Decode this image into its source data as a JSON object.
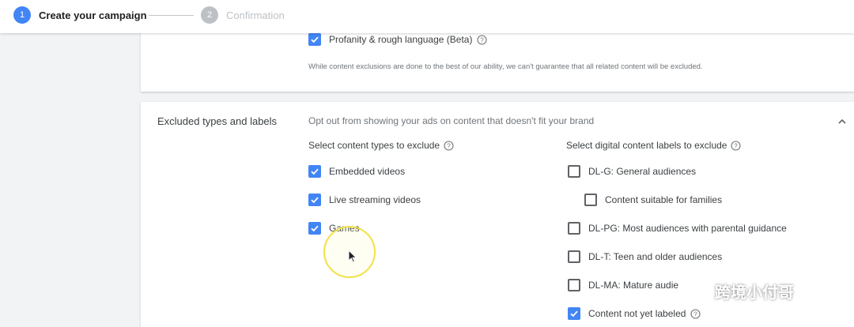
{
  "stepper": {
    "steps": [
      {
        "number": "1",
        "label": "Create your campaign"
      },
      {
        "number": "2",
        "label": "Confirmation"
      }
    ]
  },
  "top_card": {
    "partial_option": "Profanity & rough language (Beta)",
    "disclaimer": "While content exclusions are done to the best of our ability, we can't guarantee that all related content will be excluded."
  },
  "excluded_section": {
    "title": "Excluded types and labels",
    "description": "Opt out from showing your ads on content that doesn't fit your brand",
    "content_types": {
      "heading": "Select content types to exclude",
      "items": [
        {
          "label": "Embedded videos",
          "checked": true
        },
        {
          "label": "Live streaming videos",
          "checked": true
        },
        {
          "label": "Games",
          "checked": true
        }
      ]
    },
    "digital_labels": {
      "heading": "Select digital content labels to exclude",
      "items": [
        {
          "label": "DL-G: General audiences",
          "checked": false
        },
        {
          "label": "Content suitable for families",
          "checked": false
        },
        {
          "label": "DL-PG: Most audiences with parental guidance",
          "checked": false
        },
        {
          "label": "DL-T: Teen and older audiences",
          "checked": false
        },
        {
          "label": "DL-MA: Mature audie",
          "checked": false
        },
        {
          "label": "Content not yet labeled",
          "checked": true
        }
      ]
    }
  },
  "watermark": {
    "text": "跨境小付哥"
  },
  "colors": {
    "accent": "#4285f4",
    "checkbox_border": "#5f6368",
    "muted_text": "#70757a",
    "cursor_highlight": "#f1e24a"
  }
}
